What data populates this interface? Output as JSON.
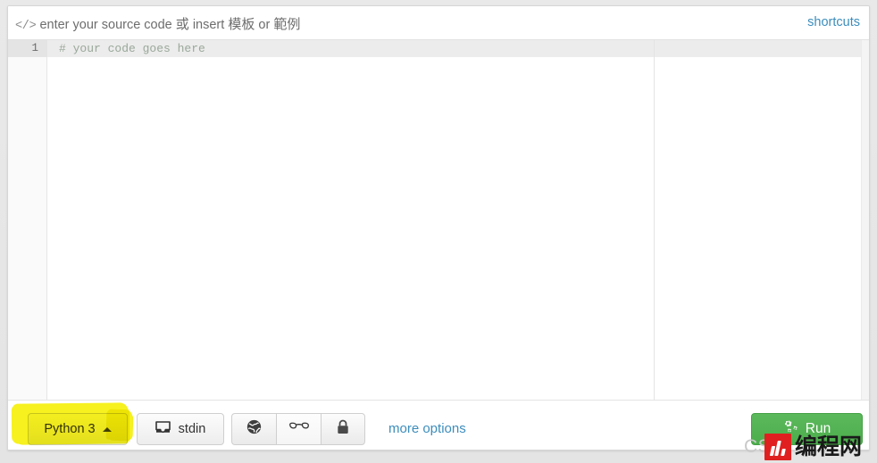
{
  "header": {
    "code_tag": "</>",
    "text_before": "enter your source code",
    "cjk_or": "或",
    "text_insert": "insert",
    "link_template": "模板",
    "text_or": "or",
    "link_example": "範例",
    "shortcuts_label": "shortcuts"
  },
  "editor": {
    "line_number": "1",
    "code_text": "# your code goes here",
    "language_placeholder": "# your code goes here"
  },
  "toolbar": {
    "language_label": "Python 3",
    "language_caret_icon": "caret-up-icon",
    "stdin_label": "stdin",
    "stdin_icon": "inbox-icon",
    "group_buttons": [
      {
        "name": "globe-button",
        "icon": "globe-icon",
        "label": "public",
        "selected": false
      },
      {
        "name": "spectacles-button",
        "icon": "spectacles-icon",
        "label": "secret",
        "selected": true
      },
      {
        "name": "lock-button",
        "icon": "lock-icon",
        "label": "private",
        "selected": false
      }
    ],
    "more_options_label": "more options",
    "run_label": "Run",
    "run_icon": "cogs-icon"
  },
  "annotations": {
    "highlight_color": "#f5f000",
    "highlight_target": "Python 3"
  },
  "watermark": {
    "faded_text": "CSD",
    "logo_text": "编程网"
  },
  "colors": {
    "link": "#3c8dbc",
    "run_green": "#5cb85c",
    "page_bg": "#e8e8e8",
    "card_bg": "#ffffff",
    "gutter_bg": "#fafafa",
    "comment": "#9aa89a"
  }
}
